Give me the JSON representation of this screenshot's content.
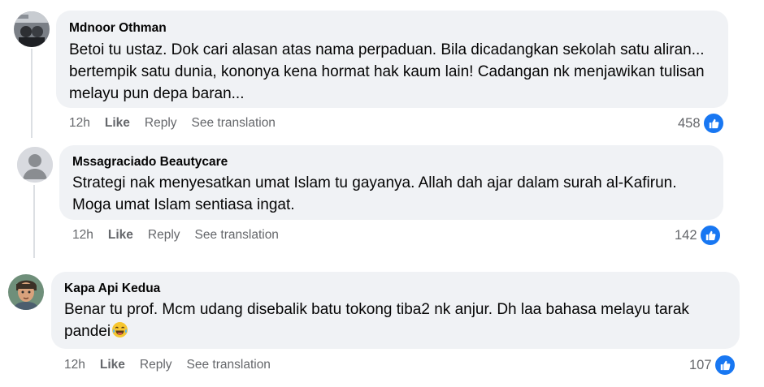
{
  "colors": {
    "bubble": "#f0f2f5",
    "meta_text": "#65676b",
    "like_blue": "#1877f2",
    "thread_line": "#dcdfe3"
  },
  "comments": [
    {
      "author": "Mdnoor Othman",
      "text": "Betoi tu ustaz. Dok cari alasan atas nama perpaduan. Bila dicadangkan sekolah satu aliran... bertempik satu dunia, kononya kena hormat hak kaum lain! Cadangan nk menjawikan tulisan melayu pun depa baran...",
      "time": "12h",
      "like": "Like",
      "reply": "Reply",
      "translate": "See translation",
      "reactions": "458",
      "reaction_icon": "thumbs-up-icon",
      "avatar": "photo-avatar"
    },
    {
      "author": "Mssagraciado Beautycare",
      "text": "Strategi nak menyesatkan umat Islam tu gayanya. Allah dah ajar dalam surah al-Kafirun. Moga umat Islam sentiasa ingat.",
      "time": "12h",
      "like": "Like",
      "reply": "Reply",
      "translate": "See translation",
      "reactions": "142",
      "reaction_icon": "thumbs-up-icon",
      "avatar": "default-avatar"
    },
    {
      "author": "Kapa Api Kedua",
      "text": "Benar tu prof. Mcm udang disebalik batu tokong tiba2 nk anjur. Dh laa bahasa melayu tarak pandei",
      "emoji": "laughing-crying-emoji",
      "time": "12h",
      "like": "Like",
      "reply": "Reply",
      "translate": "See translation",
      "reactions": "107",
      "reaction_icon": "thumbs-up-icon",
      "avatar": "cartoon-avatar"
    }
  ]
}
